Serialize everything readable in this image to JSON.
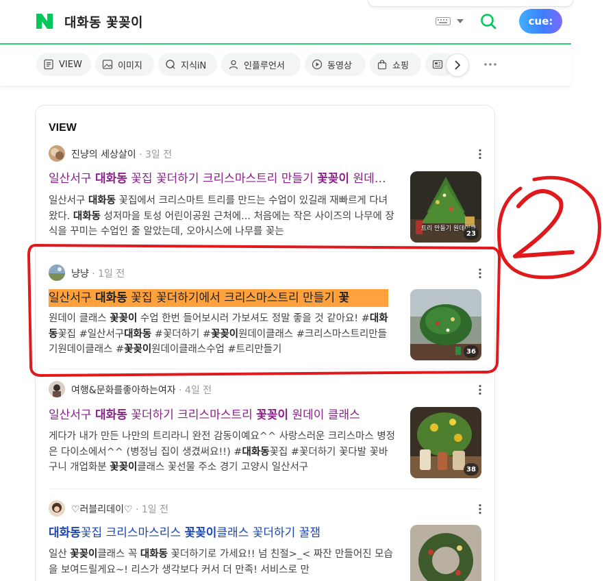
{
  "header": {
    "logo_letter": "N",
    "query": "대화동 꽃꽂이",
    "cue_label": "cue:"
  },
  "tabs": [
    {
      "label": "VIEW",
      "icon": "document-icon"
    },
    {
      "label": "이미지",
      "icon": "image-icon"
    },
    {
      "label": "지식iN",
      "icon": "q-icon"
    },
    {
      "label": "인플루언서",
      "icon": "person-icon"
    },
    {
      "label": "동영상",
      "icon": "play-icon"
    },
    {
      "label": "쇼핑",
      "icon": "bag-icon"
    },
    {
      "label": "",
      "icon": "news-icon"
    }
  ],
  "section": {
    "title": "VIEW"
  },
  "results": [
    {
      "author": "진냥의 세상살이",
      "date": " · 3일 전",
      "title_parts": [
        "일산서구 ",
        "대화동",
        " 꽃집 꽃더하기 크리스마스트리 만들기 ",
        "꽃꽂이",
        " 원데이클래스"
      ],
      "desc_html_parts": [
        [
          "일산서구 ",
          false
        ],
        [
          "대화동",
          true
        ],
        [
          " 꽃집에서 크리스마트 트리를 만드는 수업이 있길래 재빠르게 다녀왔다. ",
          false
        ],
        [
          "대화동",
          true
        ],
        [
          " 성저마을 토성 어린이공원 근처에... 처음에는 작은 사이즈의 나무에 장식을 꾸미는 수업인 줄 알았는데, 오아시스에 나무를 꽂는",
          false
        ]
      ],
      "thumb_caption": "트리 만들기 원데이클",
      "image_count": "23"
    },
    {
      "author": "냥냥",
      "date": " · 1일 전",
      "title_parts": [
        "일산서구 ",
        "대화동",
        " 꽃집 꽃더하기에서 크리스마스트리 만들기 ",
        "꽃",
        ""
      ],
      "desc_html_parts": [
        [
          "원데이 클래스 ",
          false
        ],
        [
          "꽃꽂이",
          true
        ],
        [
          " 수업 한번 들어보시러 가보셔도 정말 좋을 것 같아요! #",
          false
        ],
        [
          "대화동",
          true
        ],
        [
          "꽃집 #일산서구",
          false
        ],
        [
          "대화동",
          true
        ],
        [
          " #꽃더하기 #",
          false
        ],
        [
          "꽃꽂이",
          true
        ],
        [
          "원데이클래스 #크리스마스트리만들기원데이클래스 #",
          false
        ],
        [
          "꽃꽂이",
          true
        ],
        [
          "원데이클래스수업 #트리만들기",
          false
        ]
      ],
      "image_count": "36"
    },
    {
      "author": "여행&문화를좋아하는여자",
      "date": " · 4일 전",
      "title_parts": [
        "일산서구 ",
        "대화동",
        " 꽃더하기 크리스마스트리 ",
        "꽃꽂이",
        " 원데이 클래스"
      ],
      "desc_html_parts": [
        [
          "게다가 내가 만든 나만의 트리라니 완전 감동이예요^^ 사랑스러운 크리스마스 병정은 다이소에서^^ (병정님 집이 생겼써요!!) #",
          false
        ],
        [
          "대화동",
          true
        ],
        [
          "꽃집 #꽃더하기 꽃다발 꽃바구니 개업화분 ",
          false
        ],
        [
          "꽃꽂이",
          true
        ],
        [
          "클래스 꽃선물 주소 경기 고양시 일산서구",
          false
        ]
      ],
      "image_count": "38"
    },
    {
      "author": "♡러블리데이♡",
      "date": " · 1일 전",
      "title_parts": [
        "",
        "대화동",
        "꽃집 크리스마스리스 ",
        "꽃꽂이",
        "클래스 꽃더하기 꿀잼"
      ],
      "desc_html_parts": [
        [
          "일산 ",
          false
        ],
        [
          "꽃꽂이",
          true
        ],
        [
          "클래스 꼭 ",
          false
        ],
        [
          "대화동",
          true
        ],
        [
          " 꽃더하기로 가세요!! 넘 친절>_< 짜잔 만들어진 모습을 보여드릴게요~! 리스가 생각보다 커서 더 만족! 서비스로 만",
          false
        ]
      ],
      "image_count": ""
    }
  ],
  "annotation": {
    "number": "2",
    "color": "#e0191c"
  },
  "colors": {
    "naver_green": "#03c75a",
    "visited_title": "#8b1f8b",
    "link_title": "#1a46b6",
    "highlight": "#ffa23d"
  }
}
